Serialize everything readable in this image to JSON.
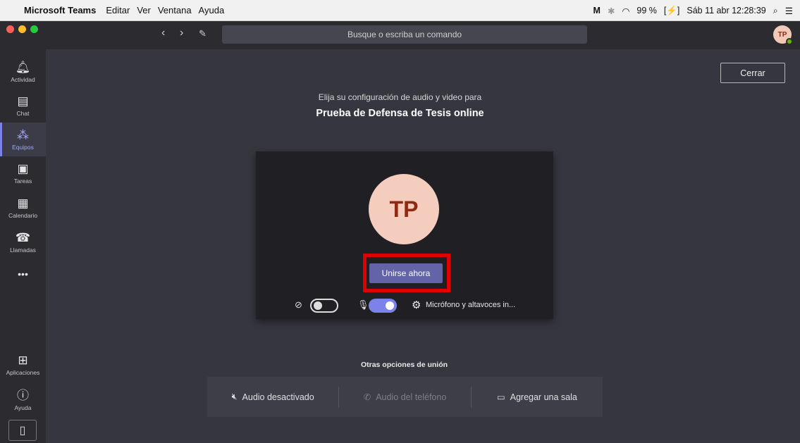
{
  "menubar": {
    "app_name": "Microsoft Teams",
    "items": [
      "Editar",
      "Ver",
      "Ventana",
      "Ayuda"
    ],
    "battery": "99 %",
    "datetime": "Sáb 11 abr  12:28:39"
  },
  "toolbar": {
    "search_placeholder": "Busque o escriba un comando",
    "avatar_initials": "TP"
  },
  "rail": {
    "items": [
      {
        "label": "Actividad",
        "icon": "bell-icon"
      },
      {
        "label": "Chat",
        "icon": "chat-icon"
      },
      {
        "label": "Equipos",
        "icon": "teams-icon"
      },
      {
        "label": "Tareas",
        "icon": "tasks-icon"
      },
      {
        "label": "Calendario",
        "icon": "calendar-icon"
      },
      {
        "label": "Llamadas",
        "icon": "phone-icon"
      }
    ],
    "more": "•••",
    "apps_label": "Aplicaciones",
    "help_label": "Ayuda"
  },
  "meeting": {
    "close_label": "Cerrar",
    "subtitle": "Elija su configuración de audio y video para",
    "title": "Prueba de Defensa de Tesis online",
    "avatar_initials": "TP",
    "join_label": "Unirse ahora",
    "device_label": "Micrófono y altavoces in...",
    "camera_on": false,
    "mic_on": true
  },
  "other_options": {
    "title": "Otras opciones de unión",
    "items": [
      {
        "label": "Audio desactivado",
        "enabled": true
      },
      {
        "label": "Audio del teléfono",
        "enabled": false
      },
      {
        "label": "Agregar una sala",
        "enabled": true
      }
    ]
  },
  "colors": {
    "accent": "#6264a7",
    "highlight": "#e00000"
  }
}
